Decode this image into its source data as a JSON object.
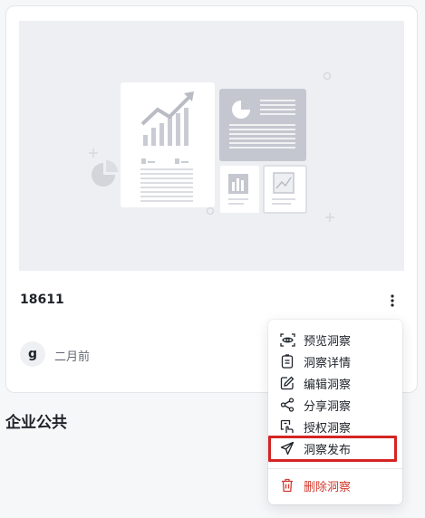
{
  "card": {
    "title": "18611",
    "author_initial": "g",
    "time": "二月前"
  },
  "section": {
    "title": "企业公共"
  },
  "menu": {
    "items": [
      {
        "label": "预览洞察",
        "icon": "eye-icon"
      },
      {
        "label": "洞察详情",
        "icon": "document-icon"
      },
      {
        "label": "编辑洞察",
        "icon": "edit-icon"
      },
      {
        "label": "分享洞察",
        "icon": "share-icon"
      },
      {
        "label": "授权洞察",
        "icon": "authorize-icon"
      },
      {
        "label": "洞察发布",
        "icon": "send-icon"
      },
      {
        "label": "删除洞察",
        "icon": "trash-icon"
      }
    ]
  },
  "colors": {
    "danger": "#d23b2f",
    "highlight": "#d42424",
    "thumbnail_bg": "#eeeff3"
  }
}
